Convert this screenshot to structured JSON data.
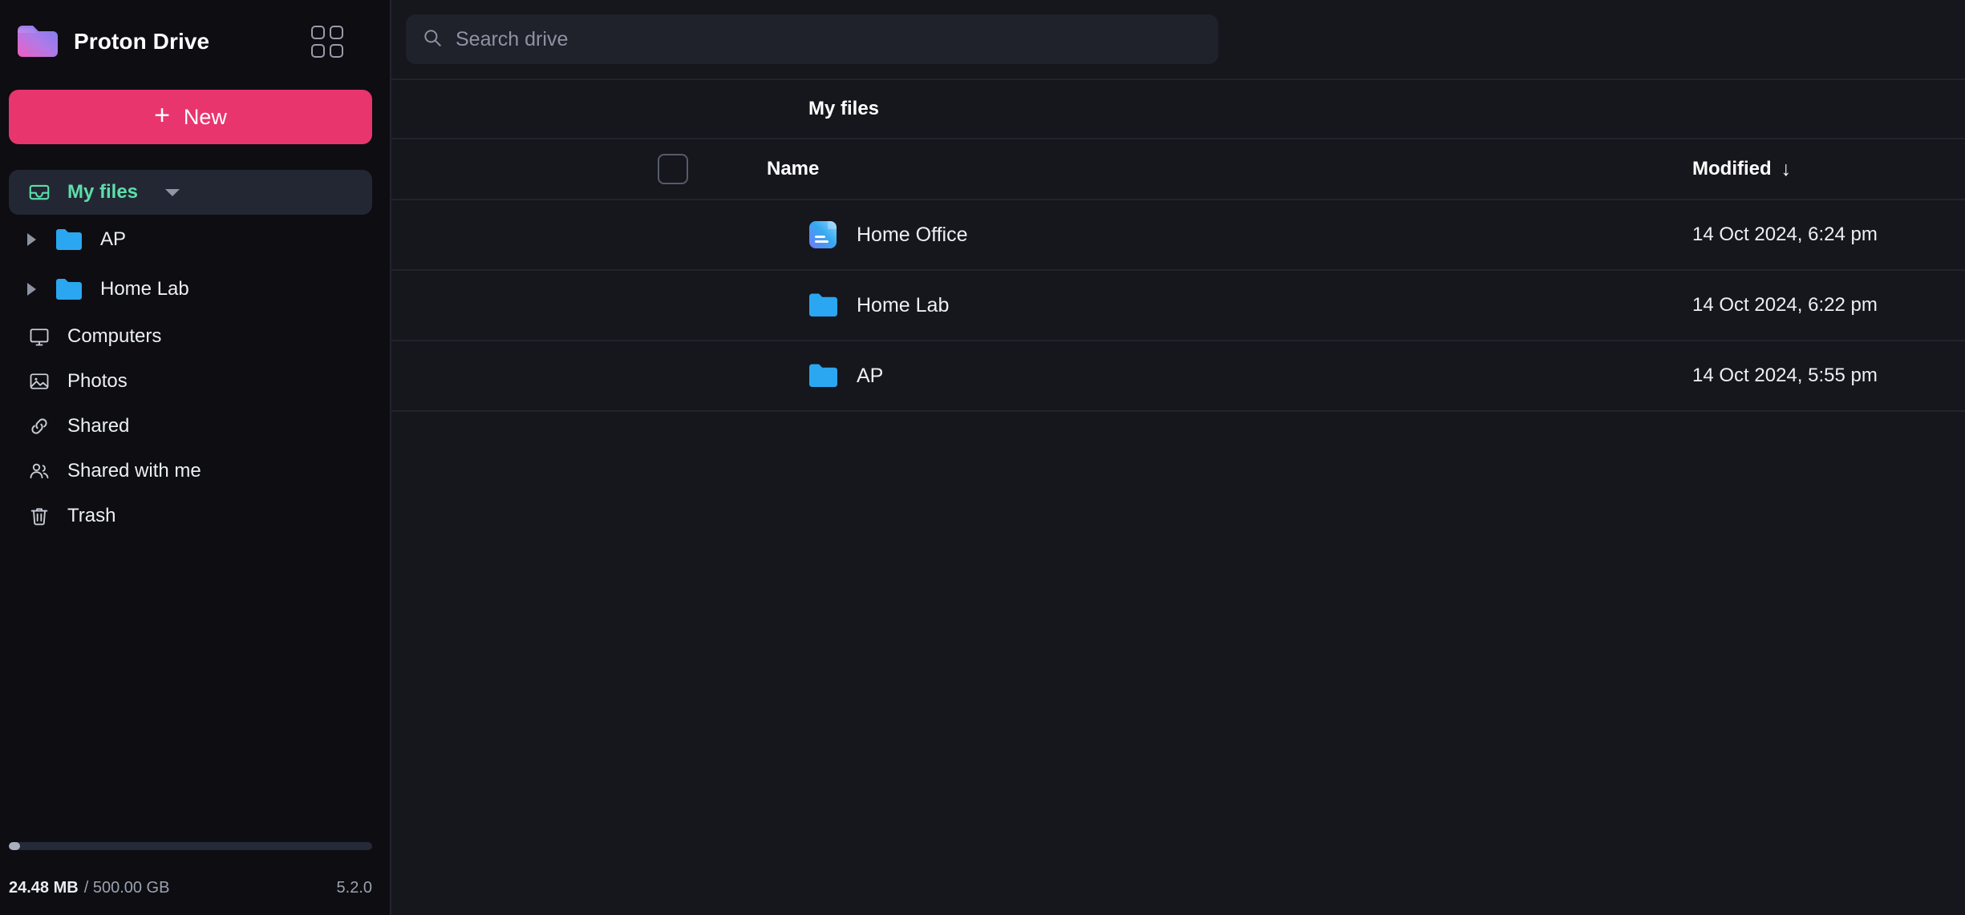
{
  "brand": {
    "name": "Proton Drive",
    "logo_icon": "proton-drive-folder-logo",
    "apps_icon": "apps-grid-icon"
  },
  "sidebar": {
    "new_button": {
      "label": "New",
      "icon": "plus-icon",
      "color": "#e8356d"
    },
    "nav": [
      {
        "label": "My files",
        "icon": "inbox-tray-icon",
        "active": true,
        "has_caret": true
      },
      {
        "label": "Computers",
        "icon": "monitor-icon",
        "active": false
      },
      {
        "label": "Photos",
        "icon": "image-icon",
        "active": false
      },
      {
        "label": "Shared",
        "icon": "link-icon",
        "active": false
      },
      {
        "label": "Shared with me",
        "icon": "people-icon",
        "active": false
      },
      {
        "label": "Trash",
        "icon": "trash-icon",
        "active": false
      }
    ],
    "tree": [
      {
        "label": "AP",
        "icon": "folder-icon",
        "arrow": "chevron-right-icon"
      },
      {
        "label": "Home Lab",
        "icon": "folder-icon",
        "arrow": "chevron-right-icon"
      }
    ],
    "storage": {
      "used": "24.48 MB",
      "separator_and_total": "/ 500.00 GB",
      "percent": 0.0049,
      "version": "5.2.0"
    }
  },
  "search": {
    "placeholder": "Search drive",
    "value": "",
    "icon": "search-icon"
  },
  "breadcrumb": {
    "current": "My files"
  },
  "table": {
    "columns": {
      "name": "Name",
      "modified": "Modified"
    },
    "sort": {
      "column": "Modified",
      "direction": "desc",
      "glyph": "↓"
    },
    "select_all_checked": false,
    "rows": [
      {
        "name": "Home Office",
        "icon": "document-gradient-icon",
        "modified": "14 Oct 2024, 6:24 pm"
      },
      {
        "name": "Home Lab",
        "icon": "folder-icon",
        "modified": "14 Oct 2024, 6:22 pm"
      },
      {
        "name": "AP",
        "icon": "folder-icon",
        "modified": "14 Oct 2024, 5:55 pm"
      }
    ]
  },
  "colors": {
    "accent_pink": "#e8356d",
    "accent_green": "#5cdeab",
    "folder_blue": "#2aa7f0",
    "sidebar_bg": "#0d0d12",
    "content_bg": "#16161d"
  }
}
